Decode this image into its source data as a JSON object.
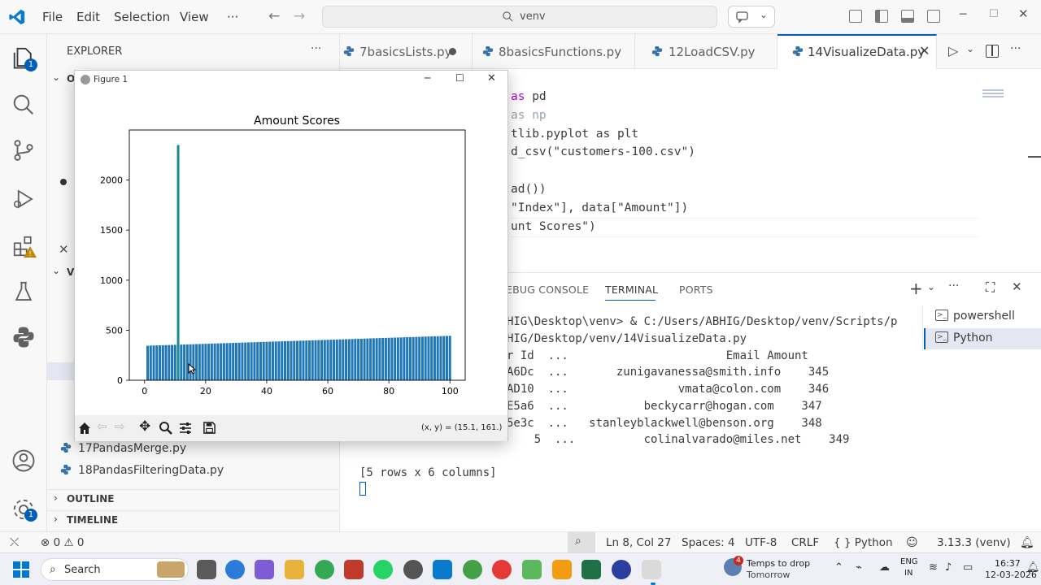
{
  "titlebar": {
    "menu": [
      "File",
      "Edit",
      "Selection",
      "View",
      "···"
    ],
    "search_text": "venv"
  },
  "activity_badges": {
    "explorer": "1",
    "manage": "1"
  },
  "sidebar": {
    "title": "EXPLORER",
    "section_o": "O",
    "section_v": "V",
    "visible_files": [
      "17PandasMerge.py",
      "18PandasFilteringData.py"
    ],
    "outline": "OUTLINE",
    "timeline": "TIMELINE"
  },
  "tabs": [
    {
      "label": "7basicsLists.py",
      "modified": true
    },
    {
      "label": "8basicsFunctions.py",
      "modified": false
    },
    {
      "label": "12LoadCSV.py",
      "modified": false
    },
    {
      "label": "14VisualizeData.py",
      "active": true
    }
  ],
  "editor": {
    "lines": [
      {
        "t1": "as",
        "t2": " pd"
      },
      {
        "t1": "as",
        "t2": " np"
      },
      {
        "t1": "",
        "t2": "tlib.pyplot as plt"
      },
      {
        "t1": "",
        "t2": "d_csv(\"customers-100.csv\")"
      },
      {
        "t1": "",
        "t2": ""
      },
      {
        "t1": "",
        "t2": "ad())"
      },
      {
        "t1": "",
        "t2": "\"Index\"], data[\"Amount\"])"
      },
      {
        "t1": "",
        "t2": "unt Scores\")"
      }
    ]
  },
  "panel": {
    "tabs": [
      "DEBUG CONSOLE",
      "TERMINAL",
      "PORTS"
    ],
    "debug_visible": "EBUG CONSOLE",
    "active_tab": "TERMINAL",
    "terminals": [
      "powershell",
      "Python"
    ],
    "lines": [
      "HIG\\Desktop\\venv> & C:/Users/ABHIG/Desktop/venv/Scripts/p",
      "HIG/Desktop/venv/14VisualizeData.py",
      "r Id  ...                       Email Amount",
      "A6Dc  ...       zunigavanessa@smith.info    345",
      "AD10  ...                vmata@colon.com    346",
      "E5a6  ...           beckycarr@hogan.com    347",
      "5e3c  ...   stanleyblackwell@benson.org    348",
      "    5  ...          colinalvarado@miles.net    349",
      "",
      "[5 rows x 6 columns]"
    ]
  },
  "statusbar": {
    "problems": "0",
    "warnings": "0",
    "position": "Ln 8, Col 27",
    "spaces": "Spaces: 4",
    "encoding": "UTF-8",
    "eol": "CRLF",
    "language": "{ } Python",
    "interpreter": "3.13.3 (venv)"
  },
  "taskbar": {
    "search": "Search",
    "weather_title": "Temps to drop",
    "weather_sub": "Tomorrow",
    "weather_badge": "4",
    "lang1": "ENG",
    "lang2": "IN",
    "time": "16:37",
    "date": "12-03-2026"
  },
  "figure": {
    "window_title": "Figure 1",
    "coords": "(x, y) = (15.1, 161.)"
  },
  "chart_data": {
    "type": "bar",
    "title": "Amount Scores",
    "xlabel": "",
    "ylabel": "",
    "xlim": [
      -5,
      105
    ],
    "ylim": [
      0,
      2500
    ],
    "xticks": [
      0,
      20,
      40,
      60,
      80,
      100
    ],
    "yticks": [
      0,
      500,
      1000,
      1500,
      2000
    ],
    "color": "#1f77b4",
    "highlight_color": "#1a8a8a",
    "series": [
      {
        "x": [
          1,
          2,
          3,
          4,
          5,
          6,
          7,
          8,
          9,
          10,
          11,
          12,
          13,
          14,
          15,
          16,
          17,
          18,
          19,
          20,
          21,
          22,
          23,
          24,
          25,
          26,
          27,
          28,
          29,
          30,
          31,
          32,
          33,
          34,
          35,
          36,
          37,
          38,
          39,
          40,
          41,
          42,
          43,
          44,
          45,
          46,
          47,
          48,
          49,
          50,
          51,
          52,
          53,
          54,
          55,
          56,
          57,
          58,
          59,
          60,
          61,
          62,
          63,
          64,
          65,
          66,
          67,
          68,
          69,
          70,
          71,
          72,
          73,
          74,
          75,
          76,
          77,
          78,
          79,
          80,
          81,
          82,
          83,
          84,
          85,
          86,
          87,
          88,
          89,
          90,
          91,
          92,
          93,
          94,
          95,
          96,
          97,
          98,
          99,
          100
        ],
        "values": [
          345,
          346,
          347,
          348,
          349,
          350,
          351,
          352,
          353,
          354,
          2350,
          356,
          357,
          358,
          359,
          360,
          361,
          362,
          363,
          364,
          365,
          366,
          367,
          368,
          369,
          370,
          371,
          372,
          373,
          374,
          375,
          376,
          377,
          378,
          379,
          380,
          381,
          382,
          383,
          384,
          385,
          386,
          387,
          388,
          389,
          390,
          391,
          392,
          393,
          394,
          395,
          396,
          397,
          398,
          399,
          400,
          401,
          402,
          403,
          404,
          405,
          406,
          407,
          408,
          409,
          410,
          411,
          412,
          413,
          414,
          415,
          416,
          417,
          418,
          419,
          420,
          421,
          422,
          423,
          424,
          425,
          426,
          427,
          428,
          429,
          430,
          431,
          432,
          433,
          434,
          435,
          436,
          437,
          438,
          439,
          440,
          441,
          442,
          443,
          444
        ]
      }
    ]
  }
}
